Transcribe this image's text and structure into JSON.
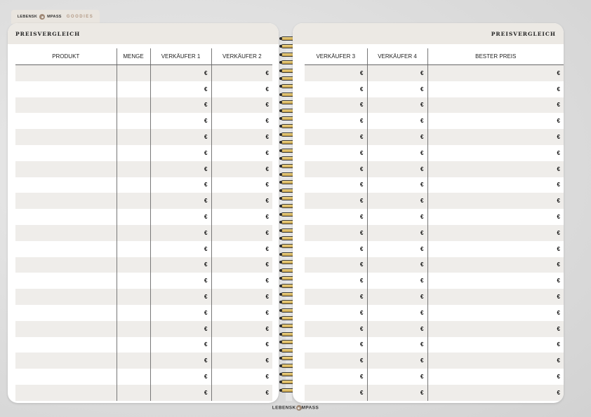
{
  "brand": {
    "left": "LEBENSK",
    "right": "MPASS",
    "tab_suffix": "GOODIES"
  },
  "left_page": {
    "title": "PREISVERGLEICH",
    "columns": [
      "PRODUKT",
      "MENGE",
      "VERKÄUFER 1",
      "VERKÄUFER 2"
    ]
  },
  "right_page": {
    "title": "PREISVERGLEICH",
    "columns": [
      "VERKÄUFER 3",
      "VERKÄUFER 4",
      "BESTER PREIS"
    ]
  },
  "currency_symbol": "€",
  "row_count": 21
}
